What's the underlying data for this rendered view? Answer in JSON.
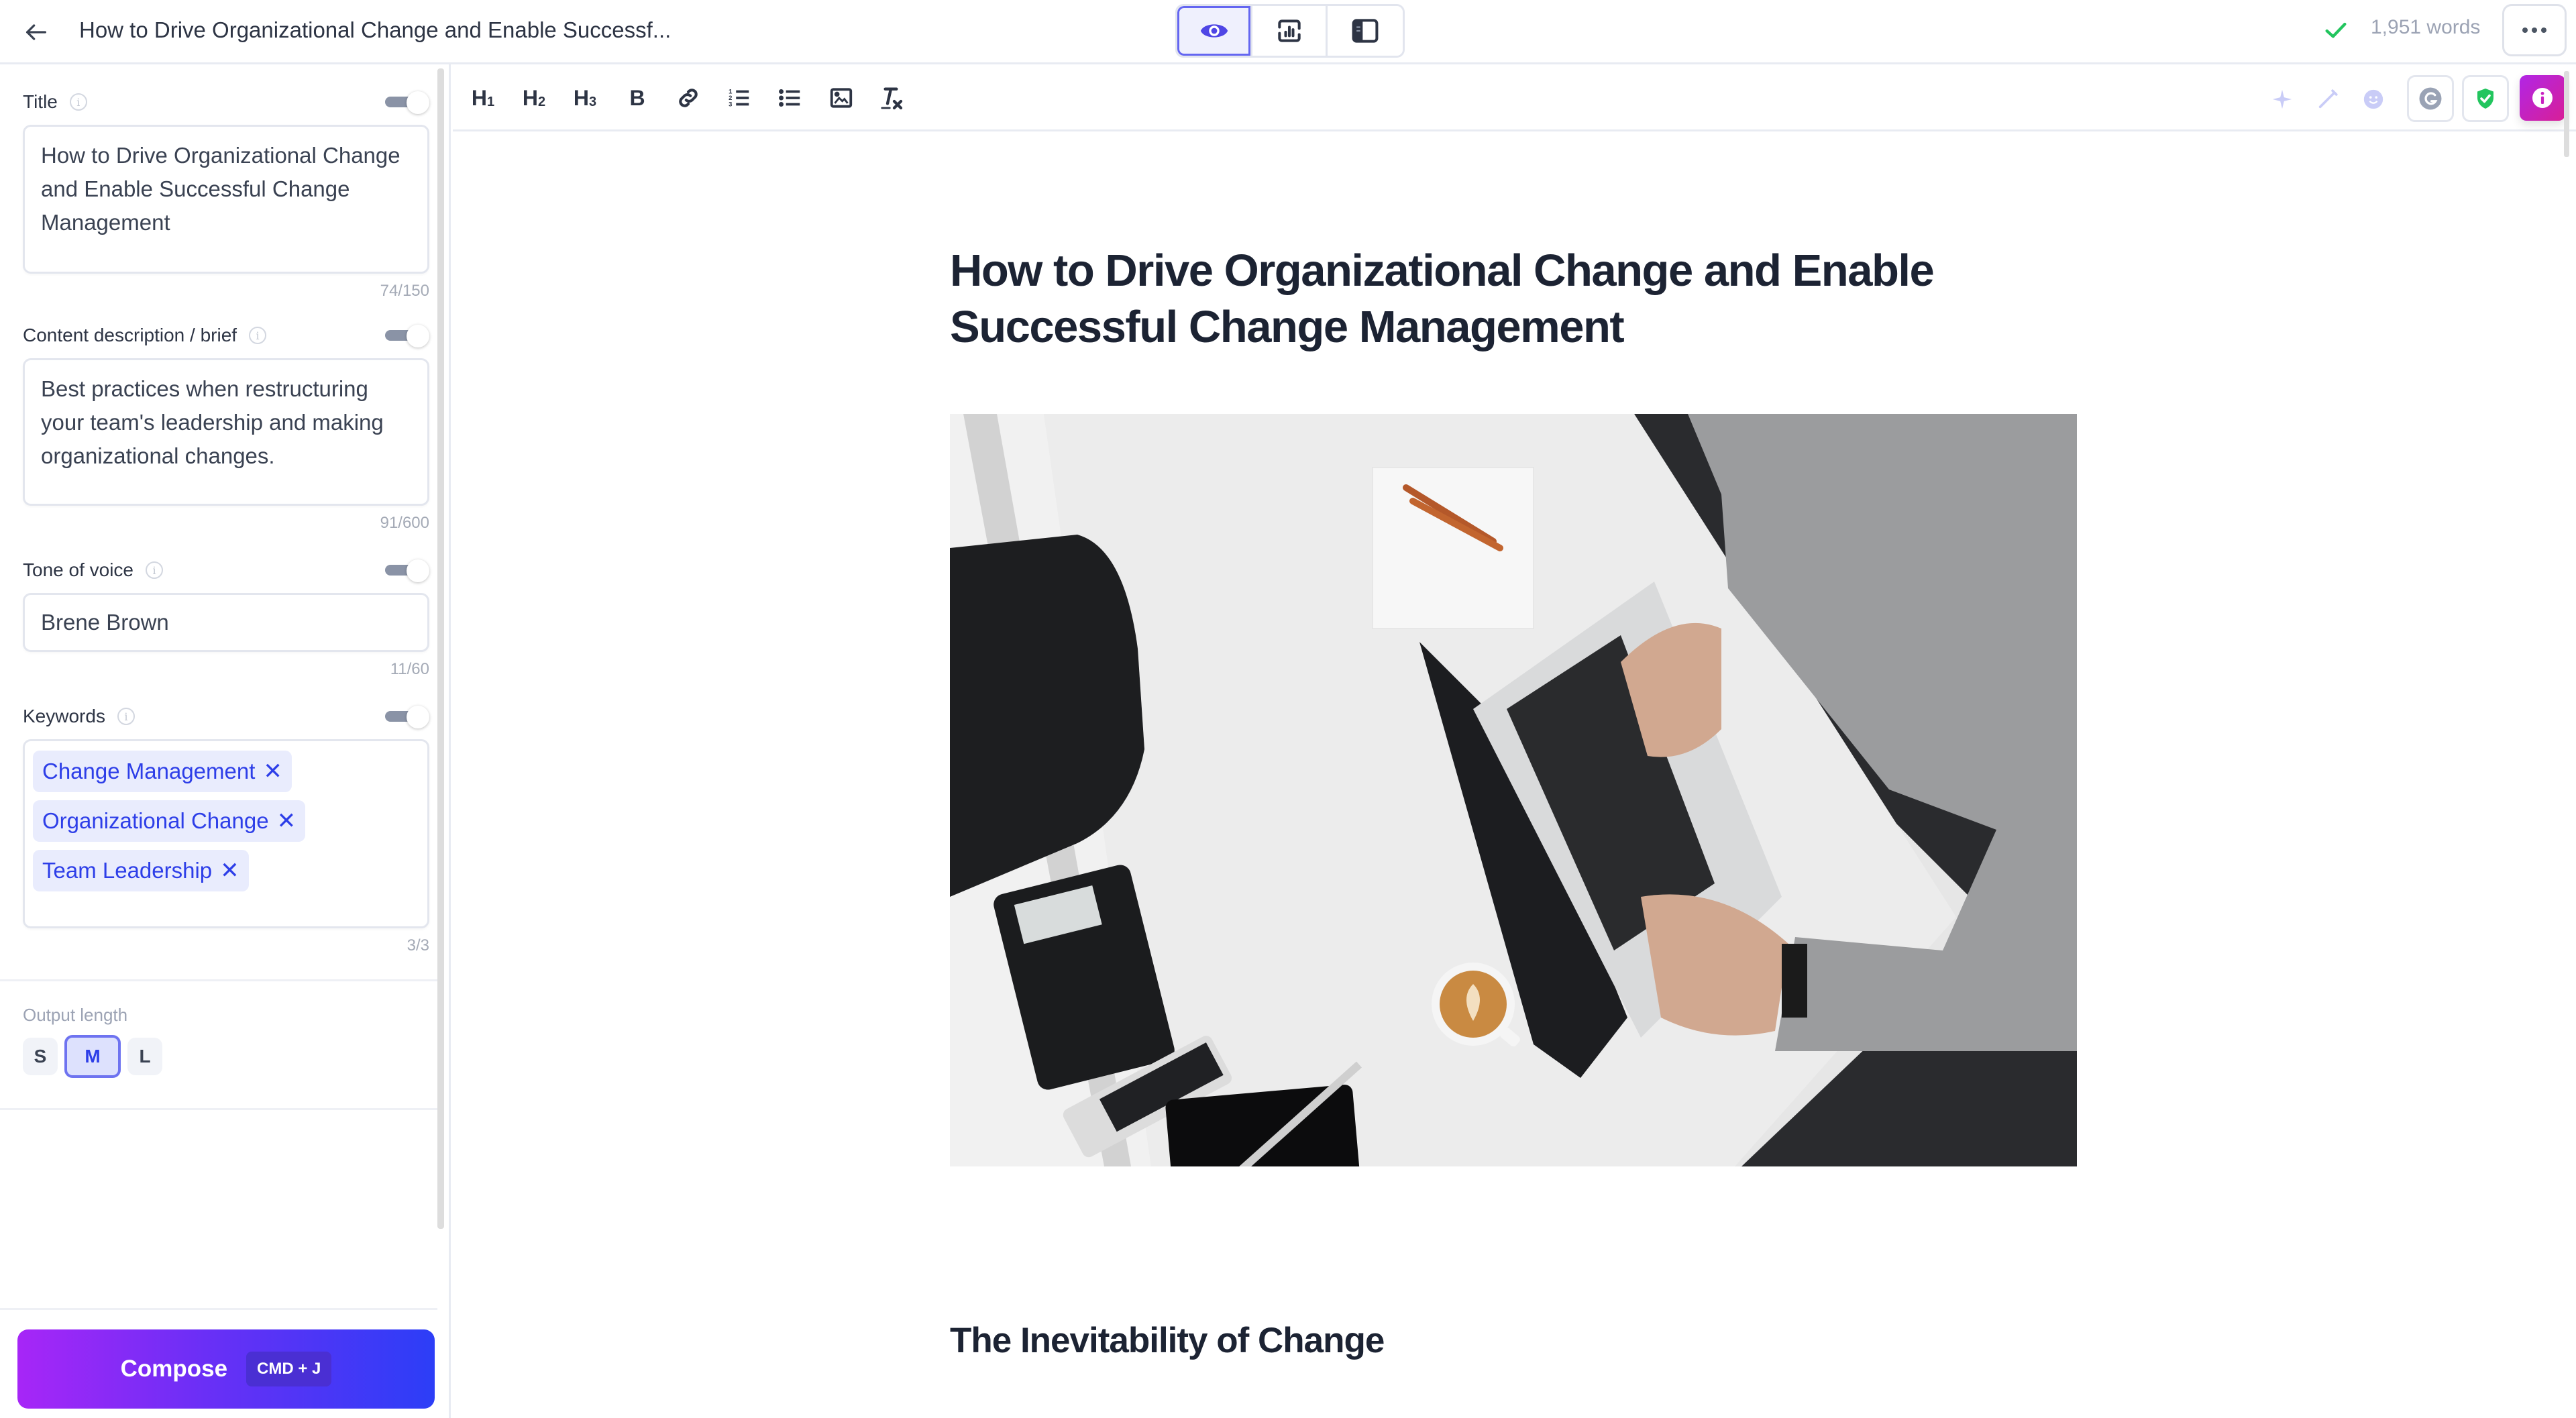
{
  "header": {
    "back_icon": "arrow-left-icon",
    "document_title": "How to Drive Organizational Change and Enable Successf...",
    "view_modes": [
      {
        "name": "preview",
        "icon": "eye-icon",
        "active": true
      },
      {
        "name": "analytics",
        "icon": "chart-refresh-icon",
        "active": false
      },
      {
        "name": "sidebar-layout",
        "icon": "sidebar-panel-icon",
        "active": false
      }
    ],
    "save_status_icon": "check-icon",
    "word_count": "1,951 words",
    "more_icon": "more-horizontal-icon"
  },
  "sidebar": {
    "title_field": {
      "label": "Title",
      "enabled": true,
      "value": "How to Drive Organizational Change and Enable Successful Change Management",
      "counter": "74/150"
    },
    "description_field": {
      "label": "Content description / brief",
      "enabled": true,
      "value": "Best practices when restructuring your team's leadership and making organizational changes.",
      "counter": "91/600"
    },
    "tone_field": {
      "label": "Tone of voice",
      "enabled": true,
      "value": "Brene Brown",
      "counter": "11/60"
    },
    "keywords_field": {
      "label": "Keywords",
      "enabled": true,
      "chips": [
        "Change Management",
        "Organizational Change",
        "Team Leadership"
      ],
      "remove_symbol": "✕",
      "counter": "3/3"
    },
    "output_length": {
      "label": "Output length",
      "options": [
        "S",
        "M",
        "L"
      ],
      "selected": "M"
    },
    "compose": {
      "label": "Compose",
      "shortcut": "CMD + J"
    }
  },
  "toolbar": {
    "format_buttons": [
      {
        "name": "heading-1",
        "label": "H",
        "sub": "1"
      },
      {
        "name": "heading-2",
        "label": "H",
        "sub": "2"
      },
      {
        "name": "heading-3",
        "label": "H",
        "sub": "3"
      },
      {
        "name": "bold",
        "label": "B"
      }
    ],
    "icon_buttons": [
      "link-icon",
      "ordered-list-icon",
      "bullet-list-icon",
      "image-icon",
      "clear-format-icon"
    ],
    "right_tools": [
      "sparkle-icon",
      "pencil-icon",
      "emoji-icon",
      "grammarly-icon",
      "shield-check-icon",
      "info-icon"
    ]
  },
  "document": {
    "heading": "How to Drive Organizational Change and Enable Successful Change Management",
    "hero_image_alt": "Overhead view of a person typing on a laptop at a white desk with phone, tablet and coffee",
    "section_heading": "The Inevitability of Change"
  },
  "colors": {
    "accent": "#6466f1",
    "chip_text": "#2d3ee8",
    "chip_bg": "#e9ecfd",
    "compose_gradient_start": "#a726f7",
    "compose_gradient_end": "#2c3ef7",
    "success": "#22c55e",
    "info_button": "#c822c0"
  }
}
